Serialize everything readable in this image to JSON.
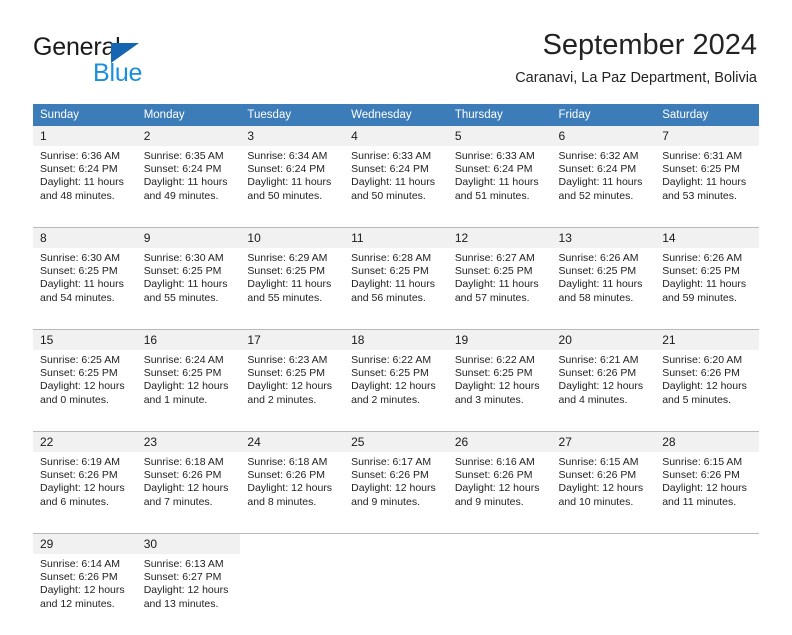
{
  "brand": {
    "name_part1": "General",
    "name_part2": "Blue",
    "triangle_color": "#1665b0",
    "blue_color": "#1a8fe0"
  },
  "header": {
    "title": "September 2024",
    "subtitle": "Caranavi, La Paz Department, Bolivia"
  },
  "theme": {
    "header_row_bg": "#3c7cb8",
    "daynum_bg": "#f1f1f1",
    "grid_line": "#b9b9b9"
  },
  "weekdays": [
    "Sunday",
    "Monday",
    "Tuesday",
    "Wednesday",
    "Thursday",
    "Friday",
    "Saturday"
  ],
  "weeks": [
    {
      "days": [
        {
          "num": "1",
          "sunrise": "Sunrise: 6:36 AM",
          "sunset": "Sunset: 6:24 PM",
          "daylight1": "Daylight: 11 hours",
          "daylight2": "and 48 minutes."
        },
        {
          "num": "2",
          "sunrise": "Sunrise: 6:35 AM",
          "sunset": "Sunset: 6:24 PM",
          "daylight1": "Daylight: 11 hours",
          "daylight2": "and 49 minutes."
        },
        {
          "num": "3",
          "sunrise": "Sunrise: 6:34 AM",
          "sunset": "Sunset: 6:24 PM",
          "daylight1": "Daylight: 11 hours",
          "daylight2": "and 50 minutes."
        },
        {
          "num": "4",
          "sunrise": "Sunrise: 6:33 AM",
          "sunset": "Sunset: 6:24 PM",
          "daylight1": "Daylight: 11 hours",
          "daylight2": "and 50 minutes."
        },
        {
          "num": "5",
          "sunrise": "Sunrise: 6:33 AM",
          "sunset": "Sunset: 6:24 PM",
          "daylight1": "Daylight: 11 hours",
          "daylight2": "and 51 minutes."
        },
        {
          "num": "6",
          "sunrise": "Sunrise: 6:32 AM",
          "sunset": "Sunset: 6:24 PM",
          "daylight1": "Daylight: 11 hours",
          "daylight2": "and 52 minutes."
        },
        {
          "num": "7",
          "sunrise": "Sunrise: 6:31 AM",
          "sunset": "Sunset: 6:25 PM",
          "daylight1": "Daylight: 11 hours",
          "daylight2": "and 53 minutes."
        }
      ]
    },
    {
      "days": [
        {
          "num": "8",
          "sunrise": "Sunrise: 6:30 AM",
          "sunset": "Sunset: 6:25 PM",
          "daylight1": "Daylight: 11 hours",
          "daylight2": "and 54 minutes."
        },
        {
          "num": "9",
          "sunrise": "Sunrise: 6:30 AM",
          "sunset": "Sunset: 6:25 PM",
          "daylight1": "Daylight: 11 hours",
          "daylight2": "and 55 minutes."
        },
        {
          "num": "10",
          "sunrise": "Sunrise: 6:29 AM",
          "sunset": "Sunset: 6:25 PM",
          "daylight1": "Daylight: 11 hours",
          "daylight2": "and 55 minutes."
        },
        {
          "num": "11",
          "sunrise": "Sunrise: 6:28 AM",
          "sunset": "Sunset: 6:25 PM",
          "daylight1": "Daylight: 11 hours",
          "daylight2": "and 56 minutes."
        },
        {
          "num": "12",
          "sunrise": "Sunrise: 6:27 AM",
          "sunset": "Sunset: 6:25 PM",
          "daylight1": "Daylight: 11 hours",
          "daylight2": "and 57 minutes."
        },
        {
          "num": "13",
          "sunrise": "Sunrise: 6:26 AM",
          "sunset": "Sunset: 6:25 PM",
          "daylight1": "Daylight: 11 hours",
          "daylight2": "and 58 minutes."
        },
        {
          "num": "14",
          "sunrise": "Sunrise: 6:26 AM",
          "sunset": "Sunset: 6:25 PM",
          "daylight1": "Daylight: 11 hours",
          "daylight2": "and 59 minutes."
        }
      ]
    },
    {
      "days": [
        {
          "num": "15",
          "sunrise": "Sunrise: 6:25 AM",
          "sunset": "Sunset: 6:25 PM",
          "daylight1": "Daylight: 12 hours",
          "daylight2": "and 0 minutes."
        },
        {
          "num": "16",
          "sunrise": "Sunrise: 6:24 AM",
          "sunset": "Sunset: 6:25 PM",
          "daylight1": "Daylight: 12 hours",
          "daylight2": "and 1 minute."
        },
        {
          "num": "17",
          "sunrise": "Sunrise: 6:23 AM",
          "sunset": "Sunset: 6:25 PM",
          "daylight1": "Daylight: 12 hours",
          "daylight2": "and 2 minutes."
        },
        {
          "num": "18",
          "sunrise": "Sunrise: 6:22 AM",
          "sunset": "Sunset: 6:25 PM",
          "daylight1": "Daylight: 12 hours",
          "daylight2": "and 2 minutes."
        },
        {
          "num": "19",
          "sunrise": "Sunrise: 6:22 AM",
          "sunset": "Sunset: 6:25 PM",
          "daylight1": "Daylight: 12 hours",
          "daylight2": "and 3 minutes."
        },
        {
          "num": "20",
          "sunrise": "Sunrise: 6:21 AM",
          "sunset": "Sunset: 6:26 PM",
          "daylight1": "Daylight: 12 hours",
          "daylight2": "and 4 minutes."
        },
        {
          "num": "21",
          "sunrise": "Sunrise: 6:20 AM",
          "sunset": "Sunset: 6:26 PM",
          "daylight1": "Daylight: 12 hours",
          "daylight2": "and 5 minutes."
        }
      ]
    },
    {
      "days": [
        {
          "num": "22",
          "sunrise": "Sunrise: 6:19 AM",
          "sunset": "Sunset: 6:26 PM",
          "daylight1": "Daylight: 12 hours",
          "daylight2": "and 6 minutes."
        },
        {
          "num": "23",
          "sunrise": "Sunrise: 6:18 AM",
          "sunset": "Sunset: 6:26 PM",
          "daylight1": "Daylight: 12 hours",
          "daylight2": "and 7 minutes."
        },
        {
          "num": "24",
          "sunrise": "Sunrise: 6:18 AM",
          "sunset": "Sunset: 6:26 PM",
          "daylight1": "Daylight: 12 hours",
          "daylight2": "and 8 minutes."
        },
        {
          "num": "25",
          "sunrise": "Sunrise: 6:17 AM",
          "sunset": "Sunset: 6:26 PM",
          "daylight1": "Daylight: 12 hours",
          "daylight2": "and 9 minutes."
        },
        {
          "num": "26",
          "sunrise": "Sunrise: 6:16 AM",
          "sunset": "Sunset: 6:26 PM",
          "daylight1": "Daylight: 12 hours",
          "daylight2": "and 9 minutes."
        },
        {
          "num": "27",
          "sunrise": "Sunrise: 6:15 AM",
          "sunset": "Sunset: 6:26 PM",
          "daylight1": "Daylight: 12 hours",
          "daylight2": "and 10 minutes."
        },
        {
          "num": "28",
          "sunrise": "Sunrise: 6:15 AM",
          "sunset": "Sunset: 6:26 PM",
          "daylight1": "Daylight: 12 hours",
          "daylight2": "and 11 minutes."
        }
      ]
    },
    {
      "days": [
        {
          "num": "29",
          "sunrise": "Sunrise: 6:14 AM",
          "sunset": "Sunset: 6:26 PM",
          "daylight1": "Daylight: 12 hours",
          "daylight2": "and 12 minutes."
        },
        {
          "num": "30",
          "sunrise": "Sunrise: 6:13 AM",
          "sunset": "Sunset: 6:27 PM",
          "daylight1": "Daylight: 12 hours",
          "daylight2": "and 13 minutes."
        },
        {
          "num": "",
          "sunrise": "",
          "sunset": "",
          "daylight1": "",
          "daylight2": ""
        },
        {
          "num": "",
          "sunrise": "",
          "sunset": "",
          "daylight1": "",
          "daylight2": ""
        },
        {
          "num": "",
          "sunrise": "",
          "sunset": "",
          "daylight1": "",
          "daylight2": ""
        },
        {
          "num": "",
          "sunrise": "",
          "sunset": "",
          "daylight1": "",
          "daylight2": ""
        },
        {
          "num": "",
          "sunrise": "",
          "sunset": "",
          "daylight1": "",
          "daylight2": ""
        }
      ]
    }
  ]
}
